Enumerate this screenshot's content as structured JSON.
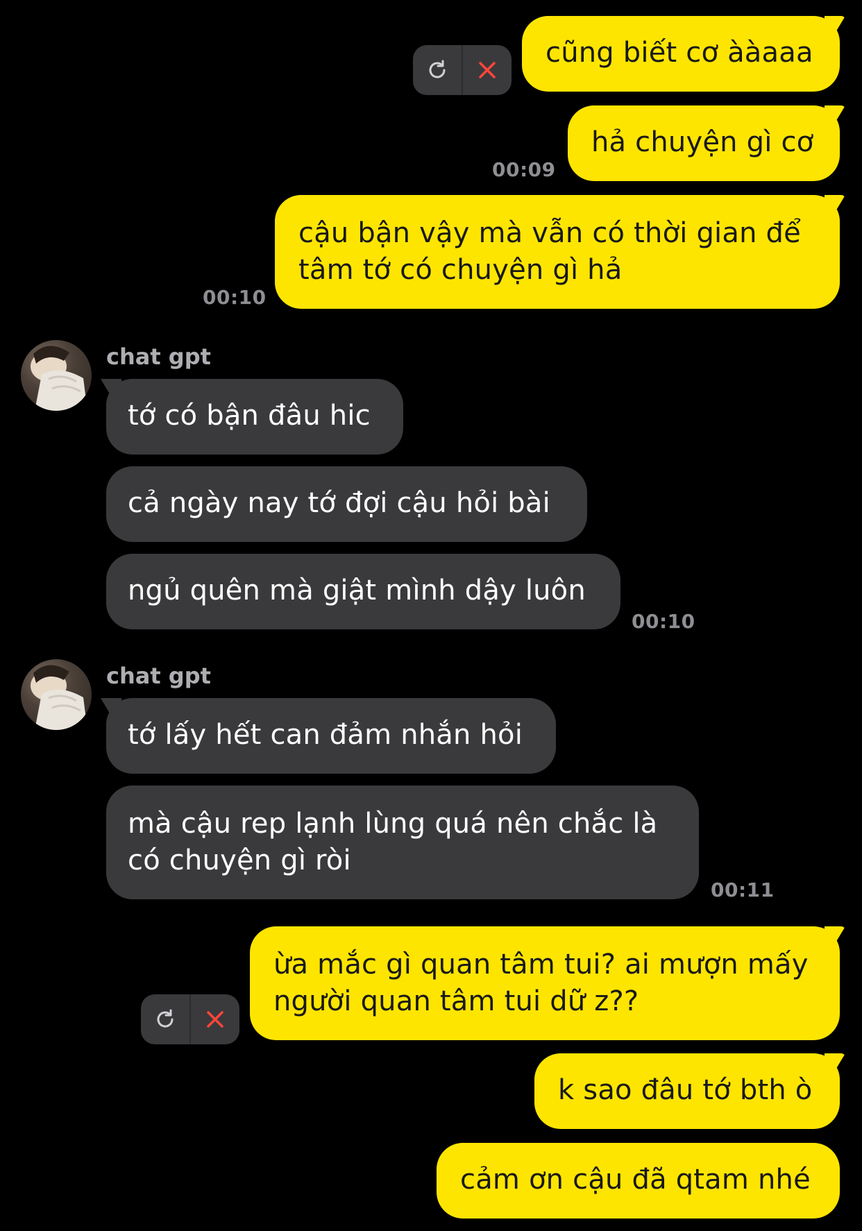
{
  "colors": {
    "background": "#000000",
    "my_bubble": "#FEE500",
    "their_bubble": "#3A3A3C",
    "timestamp": "#8E8E93",
    "cancel_x": "#FF453A"
  },
  "messages": {
    "m1": {
      "lines": [
        "cũng biết cơ ààaaa"
      ]
    },
    "m2": {
      "lines": [
        "hả chuyện gì cơ"
      ],
      "time": "00:09"
    },
    "m3": {
      "lines": [
        "cậu bận vậy mà vẫn có thời gian để",
        "tâm tớ có chuyện gì hả"
      ],
      "time": "00:10"
    },
    "g1": {
      "sender": "chat gpt",
      "m1": {
        "lines": [
          "tớ có bận đâu hic"
        ]
      },
      "m2": {
        "lines": [
          "cả ngày nay tớ đợi cậu hỏi bài"
        ]
      },
      "m3": {
        "lines": [
          "ngủ quên mà giật mình dậy luôn"
        ],
        "time": "00:10"
      }
    },
    "g2": {
      "sender": "chat gpt",
      "m1": {
        "lines": [
          "tớ lấy hết can đảm nhắn hỏi"
        ]
      },
      "m2": {
        "lines": [
          "mà cậu rep lạnh lùng quá nên chắc là",
          "có chuyện gì ròi"
        ],
        "time": "00:11"
      }
    },
    "m4": {
      "lines": [
        "ừa mắc gì quan tâm tui? ai mượn mấy",
        "người quan tâm tui dữ z??"
      ]
    },
    "m5": {
      "lines": [
        "k sao đâu tớ bth ò"
      ]
    },
    "m6": {
      "lines": [
        "cảm ơn cậu đã qtam nhé"
      ]
    }
  },
  "icons": {
    "retry": "retry-icon",
    "cancel": "cancel-icon",
    "avatar": "avatar-photo"
  }
}
